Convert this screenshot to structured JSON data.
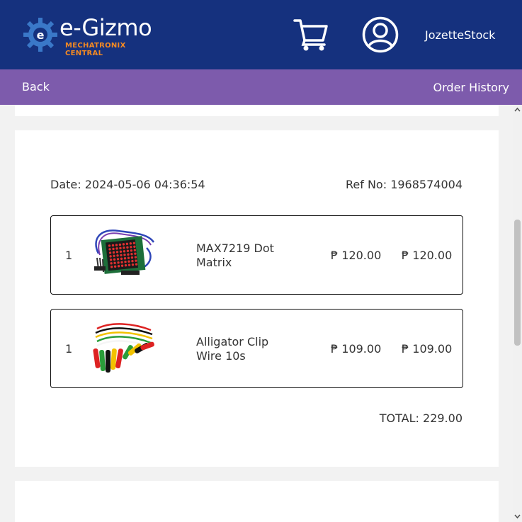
{
  "brand": {
    "name": "e-Gizmo",
    "tagline": "MECHATRONIX CENTRAL",
    "colors": {
      "header": "#15317e",
      "accent": "#f58a22",
      "subbar": "#7d5bac"
    }
  },
  "header": {
    "cart_icon": "cart-icon",
    "user_icon": "user-circle-icon",
    "username": "JozetteStock"
  },
  "subbar": {
    "back_label": "Back",
    "history_label": "Order History"
  },
  "order": {
    "date_label": "Date: 2024-05-06 04:36:54",
    "ref_label": "Ref No: 1968574004",
    "items": [
      {
        "qty": "1",
        "name": "MAX7219 Dot Matrix",
        "price": "₱ 120.00",
        "subtotal": "₱ 120.00",
        "image": "dot-matrix-module"
      },
      {
        "qty": "1",
        "name": "Alligator Clip Wire 10s",
        "price": "₱ 109.00",
        "subtotal": "₱ 109.00",
        "image": "alligator-clip-wires"
      }
    ],
    "total_label": "TOTAL: 229.00"
  }
}
